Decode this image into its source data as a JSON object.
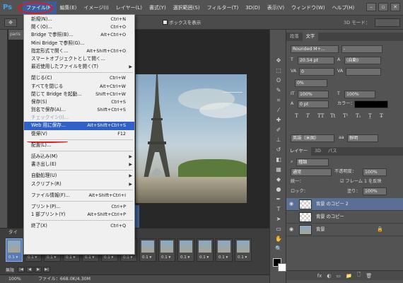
{
  "menubar": {
    "logo": "Ps",
    "items": [
      "ファイル(F)",
      "編集(E)",
      "イメージ(I)",
      "レイヤー(L)",
      "書式(Y)",
      "選択範囲(S)",
      "フィルター(T)",
      "3D(D)",
      "表示(V)",
      "ウィンドウ(W)",
      "ヘルプ(H)"
    ]
  },
  "optbar": {
    "box_label": "ボックスを表示",
    "mode_3d": "3D モード：",
    "tool_icon": "move-tool"
  },
  "document": {
    "tab": "paris"
  },
  "file_menu": {
    "items": [
      {
        "label": "新規(N)...",
        "shortcut": "Ctrl+N"
      },
      {
        "label": "開く(O)...",
        "shortcut": "Ctrl+O"
      },
      {
        "label": "Bridge で参照(B)...",
        "shortcut": "Alt+Ctrl+O"
      },
      {
        "label": "Mini Bridge で参照(G)...",
        "shortcut": ""
      },
      {
        "label": "指定形式で開く...",
        "shortcut": "Alt+Shift+Ctrl+O"
      },
      {
        "label": "スマートオブジェクトとして開く...",
        "shortcut": ""
      },
      {
        "label": "最近使用したファイルを開く(T)",
        "shortcut": "",
        "submenu": true
      },
      {
        "sep": true
      },
      {
        "label": "閉じる(C)",
        "shortcut": "Ctrl+W"
      },
      {
        "label": "すべてを閉じる",
        "shortcut": "Alt+Ctrl+W"
      },
      {
        "label": "閉じて Bridge を起動...",
        "shortcut": "Shift+Ctrl+W"
      },
      {
        "label": "保存(S)",
        "shortcut": "Ctrl+S"
      },
      {
        "label": "別名で保存(A)...",
        "shortcut": "Shift+Ctrl+S"
      },
      {
        "label": "チェックイン(I)...",
        "shortcut": "",
        "disabled": true
      },
      {
        "label": "Web 用に保存...",
        "shortcut": "Alt+Shift+Ctrl+S",
        "highlight": true
      },
      {
        "label": "復帰(V)",
        "shortcut": "F12"
      },
      {
        "sep": true
      },
      {
        "label": "配置(L)...",
        "shortcut": ""
      },
      {
        "sep": true
      },
      {
        "label": "読み込み(M)",
        "shortcut": "",
        "submenu": true
      },
      {
        "label": "書き出し(E)",
        "shortcut": "",
        "submenu": true
      },
      {
        "sep": true
      },
      {
        "label": "自動処理(U)",
        "shortcut": "",
        "submenu": true
      },
      {
        "label": "スクリプト(R)",
        "shortcut": "",
        "submenu": true
      },
      {
        "sep": true
      },
      {
        "label": "ファイル情報(F)...",
        "shortcut": "Alt+Shift+Ctrl+I"
      },
      {
        "sep": true
      },
      {
        "label": "プリント(P)...",
        "shortcut": "Ctrl+P"
      },
      {
        "label": "1 部プリント(Y)",
        "shortcut": "Alt+Shift+Ctrl+P"
      },
      {
        "sep": true
      },
      {
        "label": "終了(X)",
        "shortcut": "Ctrl+Q"
      }
    ]
  },
  "timeline": {
    "tab": "タイ",
    "frame_duration": "0.1",
    "frame_count": 13,
    "loop": "無限",
    "controls": [
      "|◀",
      "◀",
      "▶",
      "▶|"
    ]
  },
  "statusbar": {
    "zoom": "100%",
    "fileinfo": "ファイル：668.0K/4.30M"
  },
  "character_panel": {
    "tabs": [
      "段落",
      "文字"
    ],
    "font_family": "Rounded M+...",
    "font_style": "-",
    "size": "20.54 pt",
    "leading": "(自動)",
    "kerning": "0",
    "tracking": "0%",
    "vscale": "100%",
    "hscale": "100%",
    "baseline": "0 pt",
    "color_label": "カラー：",
    "language": "英語（米国）",
    "antialias": "鮮明",
    "aa_label": "aa"
  },
  "layers_panel": {
    "tabs": [
      "レイヤー",
      "3D",
      "パス"
    ],
    "search_label": "種類",
    "blend_mode": "通常",
    "opacity_label": "不透明度：",
    "opacity": "100%",
    "unify_label": "統一：",
    "propagate_label": "フレーム 1 を反映",
    "lock_label": "ロック：",
    "fill_label": "塗り：",
    "fill": "100%",
    "layers": [
      {
        "name": "背景 のコピー 2",
        "visible": true,
        "selected": true,
        "thumb": "checker"
      },
      {
        "name": "背景 のコピー",
        "visible": false,
        "selected": false,
        "thumb": "checker"
      },
      {
        "name": "背景",
        "visible": true,
        "selected": false,
        "thumb": "photo",
        "locked": true
      }
    ],
    "footer_icons": [
      "fx",
      "◐",
      "▭",
      "📁",
      "🗋",
      "🗑"
    ]
  },
  "colors": {
    "menu_highlight": "#2f61c9",
    "annotation_red": "#e0191c",
    "panel_bg": "#535353"
  }
}
